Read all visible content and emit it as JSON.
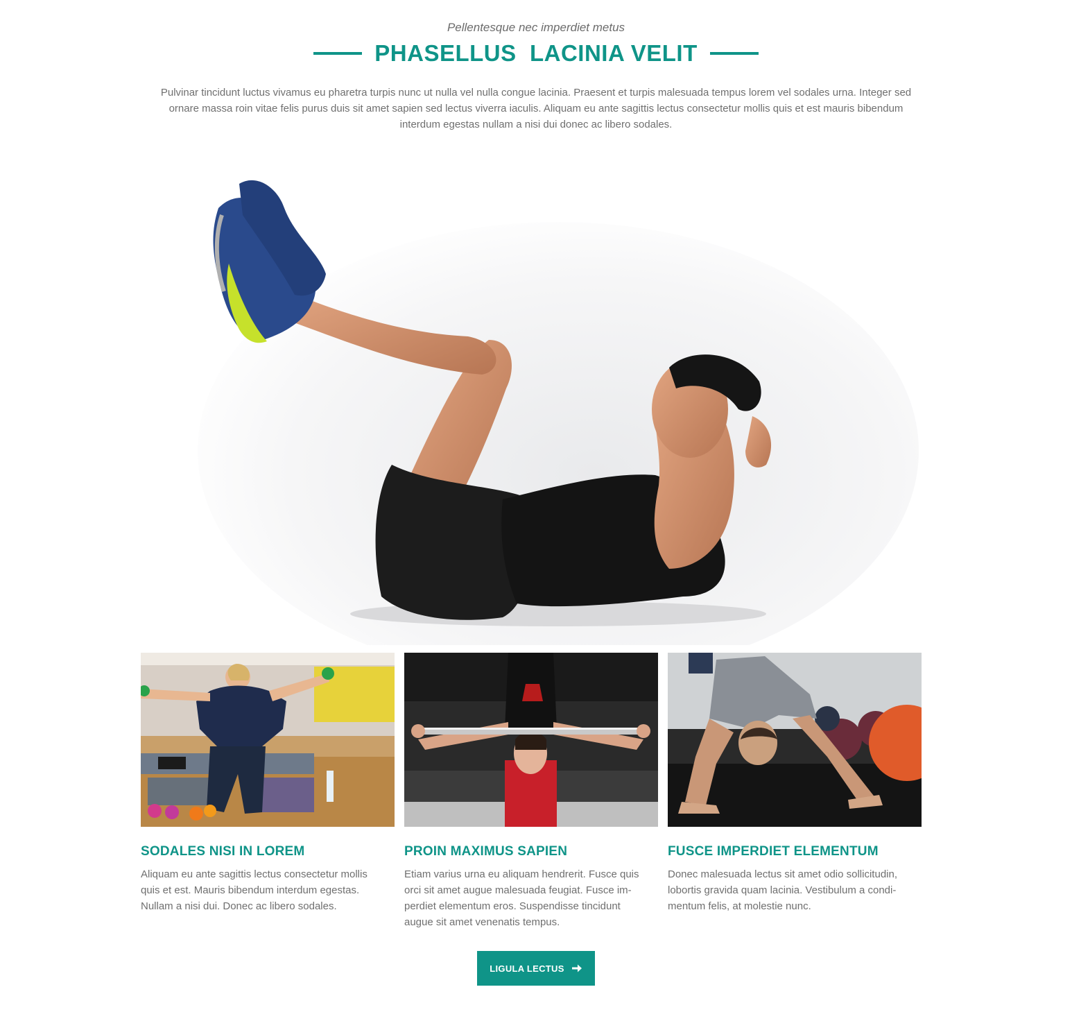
{
  "header": {
    "subtitle": "Pellentesque nec imperdiet metus",
    "title": "PHASELLUS  LACINIA VELIT",
    "intro": "Pulvinar tincidunt luctus vivamus eu pharetra turpis nunc ut nulla vel nulla congue lacinia. Praesent et turpis malesuada tempus lorem vel sodales urna. Integer sed ornare massa roin vitae felis purus duis sit amet sapien sed lectus viverra iaculis. Aliquam eu ante sagittis lectus consectetur mollis quis et est mauris bibendum interdum egestas nullam a nisi dui donec ac libero sodales."
  },
  "cards": [
    {
      "title": "SODALES NISI IN LOREM",
      "text": "Aliquam eu ante sagittis lectus consectetur mollis quis et est. Mauris bibendum interdum egestas. Nullam a nisi dui. Donec ac libero sodales."
    },
    {
      "title": "PROIN MAXIMUS SAPIEN",
      "text": "Etiam varius urna eu aliquam hendrerit. Fusce quis orci sit amet augue malesuada feugiat. Fusce im-perdiet elementum eros. Suspendisse tincidunt augue sit amet venenatis tempus."
    },
    {
      "title": "FUSCE IMPERDIET ELEMENTUM",
      "text": "Donec malesuada lectus sit amet odio sollicitudin, lobortis gravida quam lacinia. Vestibulum a condi-mentum felis, at molestie nunc."
    }
  ],
  "cta": {
    "label": "LIGULA LECTUS",
    "icon": "arrow-right-icon"
  },
  "colors": {
    "accent": "#0f9488",
    "text": "#6f6f6f"
  }
}
